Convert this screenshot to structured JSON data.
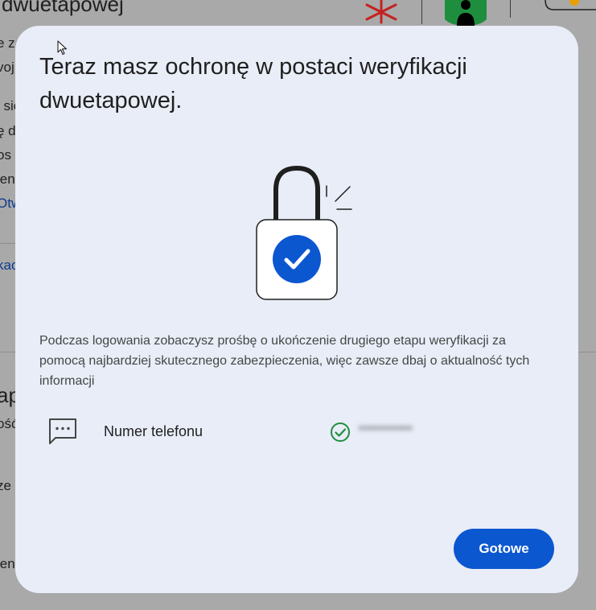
{
  "background": {
    "heading": "dwuetapowej",
    "fragments": [
      "e z",
      "voj",
      "i się",
      "ę d",
      "os",
      "ien",
      "Otw",
      "kac",
      "ap",
      "ość",
      "ze",
      "ien"
    ]
  },
  "dialog": {
    "title": "Teraz masz ochronę w postaci weryfikacji dwuetapowej.",
    "description": "Podczas logowania zobaczysz prośbę o ukończenie drugiego etapu weryfikacji za pomocą najbardziej skutecznego zabezpieczenia, więc zawsze dbaj o aktualność tych informacji",
    "method": {
      "label": "Numer telefonu",
      "icon": "sms-icon",
      "status_icon": "check-circle-icon",
      "status_color": "#1e8e3e",
      "value": "•••••••••••"
    },
    "done_label": "Gotowe"
  },
  "colors": {
    "accent": "#0b57d0",
    "dialog_bg": "#e8edf7"
  }
}
